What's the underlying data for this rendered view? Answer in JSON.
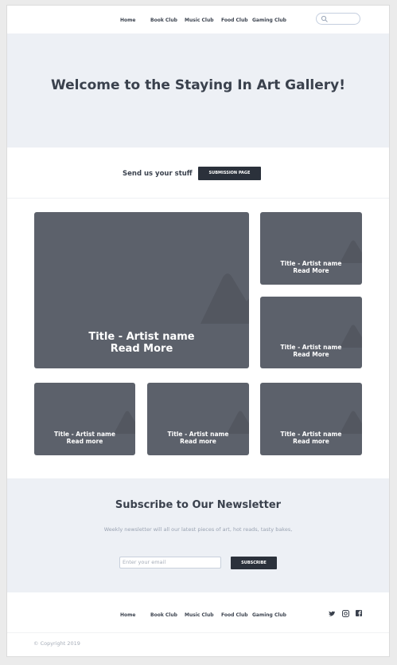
{
  "nav": {
    "items": [
      "Home",
      "Book Club",
      "Music Club",
      "Food Club",
      "Gaming Club"
    ],
    "search_placeholder": ""
  },
  "hero": {
    "title": "Welcome to the Staying In Art Gallery!"
  },
  "submit": {
    "text": "Send us your stuff",
    "button": "SUBMISSION PAGE"
  },
  "gallery": {
    "cards": [
      {
        "title": "Title - Artist name",
        "link": "Read More"
      },
      {
        "title": "Title - Artist name",
        "link": "Read More"
      },
      {
        "title": "Title - Artist name",
        "link": "Read More"
      },
      {
        "title": "Title - Artist name",
        "link": "Read more"
      },
      {
        "title": "Title - Artist name",
        "link": "Read more"
      },
      {
        "title": "Title - Artist name",
        "link": "Read more"
      }
    ]
  },
  "newsletter": {
    "title": "Subscribe to Our Newsletter",
    "description": "Weekly newsletter will all our latest pieces of art, hot reads, tasty bakes,",
    "email_placeholder": "Enter your email",
    "button": "SUBSCRIBE"
  },
  "footer": {
    "nav": [
      "Home",
      "Book Club",
      "Music Club",
      "Food Club",
      "Gaming Club"
    ],
    "social": [
      "twitter-icon",
      "instagram-icon",
      "facebook-icon"
    ],
    "copyright": "© Copyright 2019"
  },
  "colors": {
    "dark": "#2b313b",
    "card": "#5c616b",
    "light_bg": "#edf0f5"
  }
}
